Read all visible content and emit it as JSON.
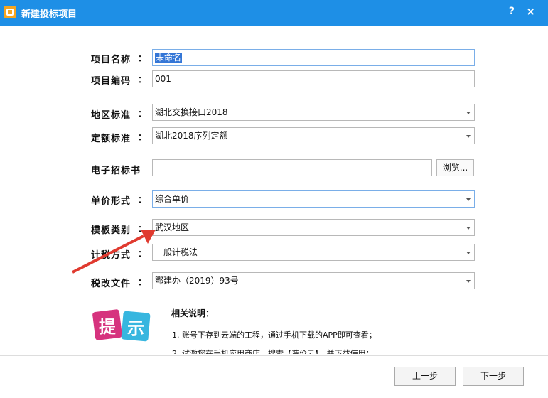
{
  "window": {
    "title": "新建投标项目",
    "help": "?",
    "close": "×"
  },
  "form": {
    "project_name": {
      "label": "项目名称",
      "value": "未命名"
    },
    "project_code": {
      "label": "项目编码",
      "value": "001"
    },
    "region_standard": {
      "label": "地区标准",
      "value": "湖北交换接口2018"
    },
    "quota_standard": {
      "label": "定额标准",
      "value": "湖北2018序列定额"
    },
    "bid_document": {
      "label": "电子招标书",
      "value": "",
      "browse": "浏览..."
    },
    "price_form": {
      "label": "单价形式",
      "value": "综合单价"
    },
    "template_type": {
      "label": "模板类别",
      "value": "武汉地区"
    },
    "tax_method": {
      "label": "计税方式",
      "value": "一般计税法"
    },
    "tax_reform": {
      "label": "税改文件",
      "value": "鄂建办（2019）93号"
    }
  },
  "colon": "：",
  "notes": {
    "icon_text": "提示",
    "title": "相关说明：",
    "line1": "1. 账号下存到云端的工程，通过手机下载的APP即可查看；",
    "line2": "2. 试激您在手机应用商店，搜索【造价云】，并下载使用；"
  },
  "buttons": {
    "prev": "上一步",
    "next": "下一步"
  },
  "colors": {
    "titlebar": "#1e8fe6",
    "arrow": "#e03a2f",
    "selection": "#3476d6"
  }
}
